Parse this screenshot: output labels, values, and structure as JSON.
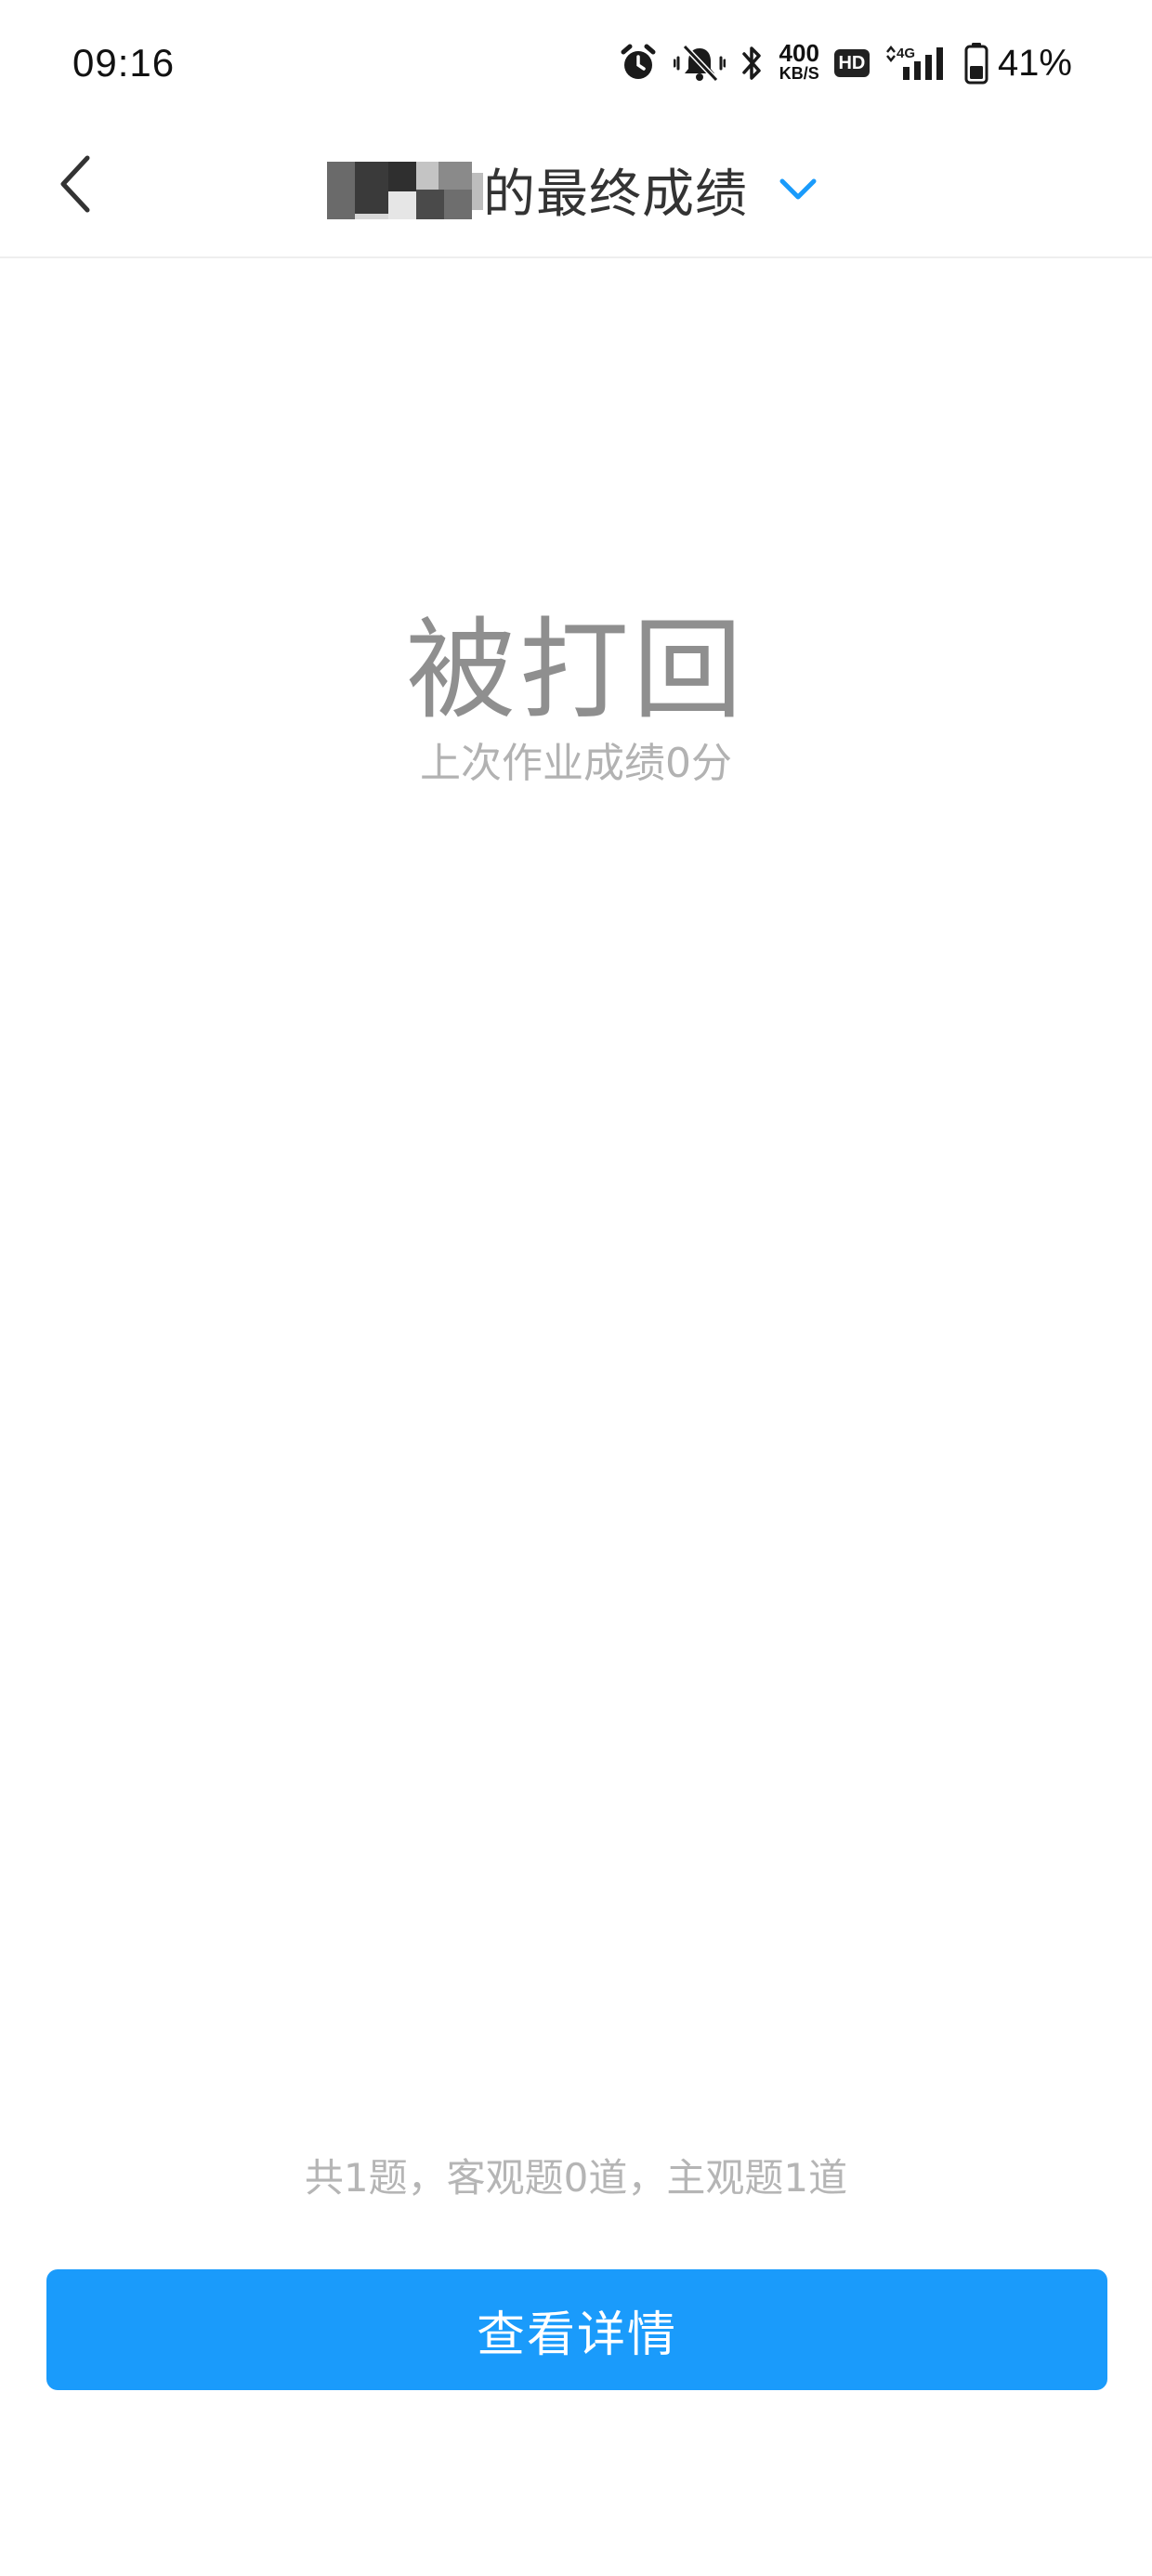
{
  "status_bar": {
    "time": "09:16",
    "net_speed_value": "400",
    "net_speed_unit": "KB/S",
    "hd_label": "HD",
    "network_type": "4G",
    "battery_percent": "41%",
    "icons": [
      "alarm-icon",
      "mute-vibrate-icon",
      "bluetooth-icon",
      "hd-badge-icon",
      "signal-4g-icon",
      "battery-icon"
    ]
  },
  "header": {
    "title_suffix": "的最终成绩",
    "back_icon": "chevron-left-icon",
    "dropdown_icon": "chevron-down-icon",
    "accent_color": "#1a9bfb"
  },
  "result": {
    "status": "被打回",
    "subtitle": "上次作业成绩0分"
  },
  "summary": {
    "text": "共1题，客观题0道，主观题1道"
  },
  "actions": {
    "detail_button_label": "查看详情",
    "button_color": "#1a9bfb"
  }
}
